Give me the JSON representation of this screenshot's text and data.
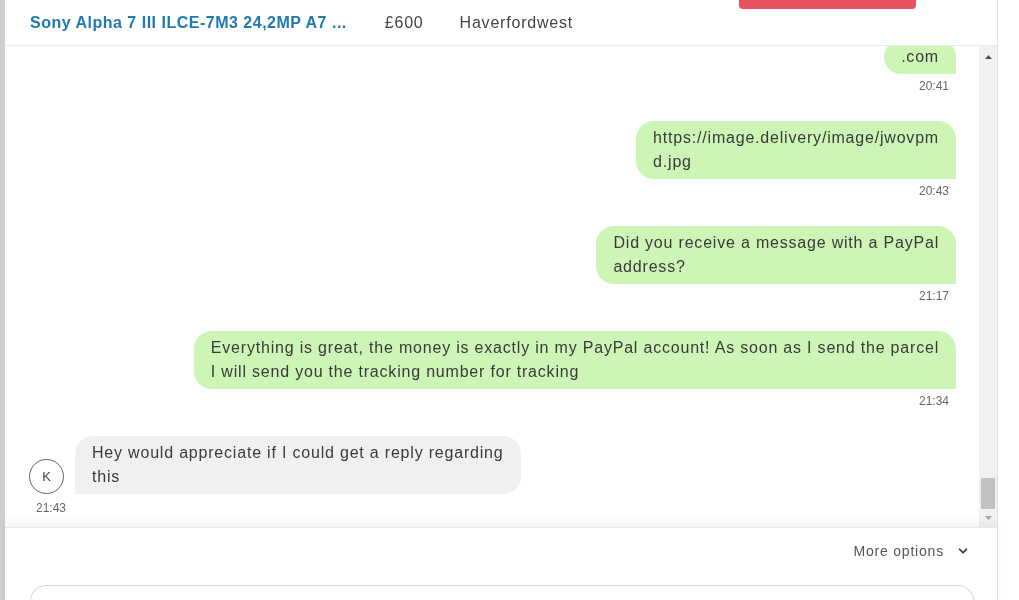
{
  "listing": {
    "title": "Sony Alpha 7 III ILCE-7M3 24,2MP A7 ...",
    "price": "£600",
    "location": "Haverfordwest"
  },
  "messages": [
    {
      "kind": "sent",
      "lines": [
        ".com"
      ],
      "time": "20:41"
    },
    {
      "kind": "sent",
      "lines": [
        "https://image.delivery/image/jwovpm",
        "d.jpg"
      ],
      "time": "20:43"
    },
    {
      "kind": "sent",
      "lines": [
        "Did you receive a message with a PayPal",
        "address?"
      ],
      "time": "21:17"
    },
    {
      "kind": "sent",
      "lines": [
        "Everything is great, the money is exactly in my PayPal account! As soon as I send the parcel",
        "I will send you the tracking number for tracking"
      ],
      "time": "21:34"
    },
    {
      "kind": "received",
      "avatar": "K",
      "lines": [
        "Hey would appreciate if I could get a reply regarding",
        "this"
      ],
      "time": "21:43"
    }
  ],
  "composer": {
    "more_options": {
      "label": "More options",
      "expanded": false
    }
  }
}
